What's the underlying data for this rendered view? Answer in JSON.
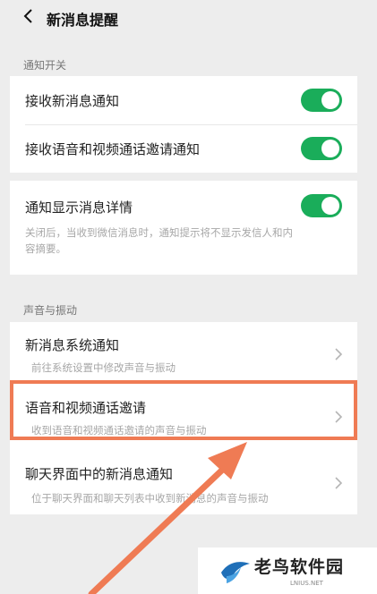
{
  "header": {
    "title": "新消息提醒"
  },
  "section1": {
    "title": "通知开关",
    "items": [
      {
        "label": "接收新消息通知",
        "on": true
      },
      {
        "label": "接收语音和视频通话邀请通知",
        "on": true
      }
    ]
  },
  "details": {
    "label": "通知显示消息详情",
    "on": true,
    "desc_line1": "关闭后，当收到微信消息时，通知提示将不显示发信人和内",
    "desc_line2": "容摘要。"
  },
  "section2": {
    "title": "声音与振动",
    "items": [
      {
        "label": "新消息系统通知",
        "desc": "前往系统设置中修改声音与振动"
      },
      {
        "label": "语音和视频通话邀请",
        "desc": "收到语音和视频通话邀请的声音与振动"
      },
      {
        "label": "聊天界面中的新消息通知",
        "desc": "位于聊天界面和聊天列表中收到新消息的声音与振动"
      }
    ]
  },
  "watermark": {
    "text": "老鸟软件园",
    "sub": "LNIUS.NET"
  },
  "colors": {
    "toggle_on": "#1aad5a",
    "highlight": "#ef7b54",
    "background": "#ededed"
  }
}
